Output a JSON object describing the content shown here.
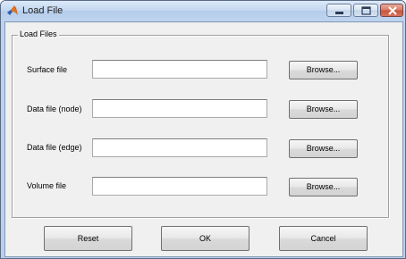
{
  "window": {
    "title": "Load File",
    "icon": "matlab-logo-icon"
  },
  "title_buttons": [
    "minimize-icon",
    "maximize-icon",
    "close-icon"
  ],
  "group": {
    "title": "Load Files"
  },
  "fields": [
    {
      "label": "Surface file",
      "value": "",
      "button": "Browse..."
    },
    {
      "label": "Data file (node)",
      "value": "",
      "button": "Browse..."
    },
    {
      "label": "Data file (edge)",
      "value": "",
      "button": "Browse..."
    },
    {
      "label": "Volume file",
      "value": "",
      "button": "Browse..."
    }
  ],
  "actions": {
    "reset_label": "Reset",
    "ok_label": "OK",
    "cancel_label": "Cancel"
  }
}
